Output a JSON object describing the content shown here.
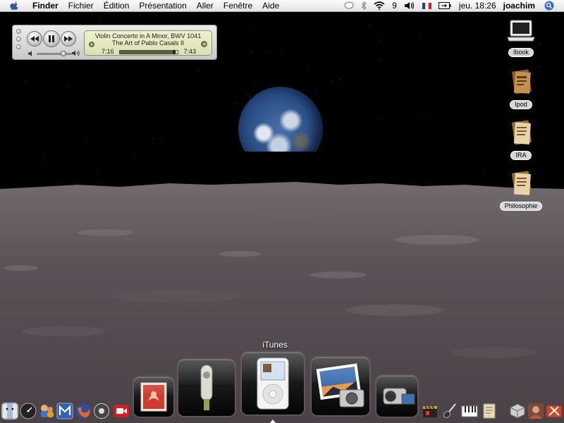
{
  "menubar": {
    "app_name": "Finder",
    "menus": [
      "Fichier",
      "Édition",
      "Présentation",
      "Aller",
      "Fenêtre",
      "Aide"
    ],
    "extras": {
      "battery_digit": "9"
    },
    "clock": "jeu. 18:26",
    "user": "joachim"
  },
  "player": {
    "track_title": "Violin Concerto in A Minor, BWV 1041",
    "album": "The Art of Pablo Casals II",
    "elapsed": "7:16",
    "duration": "7:43",
    "progress_fraction": 0.94,
    "volume_fraction": 0.75
  },
  "desktop": {
    "icons": [
      {
        "label": "Ibook",
        "icon": "laptop-icon"
      },
      {
        "label": "Ipod",
        "icon": "document-folder-icon"
      },
      {
        "label": "IRA",
        "icon": "document-folder-icon"
      },
      {
        "label": "Philosophie",
        "icon": "document-folder-icon"
      }
    ]
  },
  "dock": {
    "highlighted_label": "iTunes",
    "large_items": [
      {
        "name": "mail-stamp-icon"
      },
      {
        "name": "usb-drive-icon"
      },
      {
        "name": "ipod-icon"
      },
      {
        "name": "iphoto-icon"
      },
      {
        "name": "imovie-camcorder-icon"
      }
    ],
    "left_small_items": [
      {
        "name": "finder-icon",
        "color": "#dcdcdc"
      },
      {
        "name": "dashboard-gauge-icon",
        "color": "#222222"
      },
      {
        "name": "ichat-icon",
        "color": "#3c74c8"
      },
      {
        "name": "word-m-icon",
        "color": "#2d62b8"
      },
      {
        "name": "firefox-icon",
        "color": "#e0682a"
      },
      {
        "name": "disk-utility-icon",
        "color": "#444444"
      },
      {
        "name": "video-conference-icon",
        "color": "#d22020"
      }
    ],
    "right_small_items": [
      {
        "name": "clapper-icon",
        "color": "#c7a22b"
      },
      {
        "name": "guitar-icon",
        "color": "#3a3a3a"
      },
      {
        "name": "piano-icon",
        "color": "#505050"
      },
      {
        "name": "notes-icon",
        "color": "#e8d9b0"
      },
      {
        "name": "cube-icon",
        "color": "#cfcfcf"
      },
      {
        "name": "person-photo-icon",
        "color": "#b55a3a"
      },
      {
        "name": "tools-icon",
        "color": "#c64a2a"
      }
    ]
  },
  "colors": {
    "menubar_top": "#fbfbfb",
    "lcd_background": "#e4e7c2",
    "dock_tile": "#111111"
  }
}
